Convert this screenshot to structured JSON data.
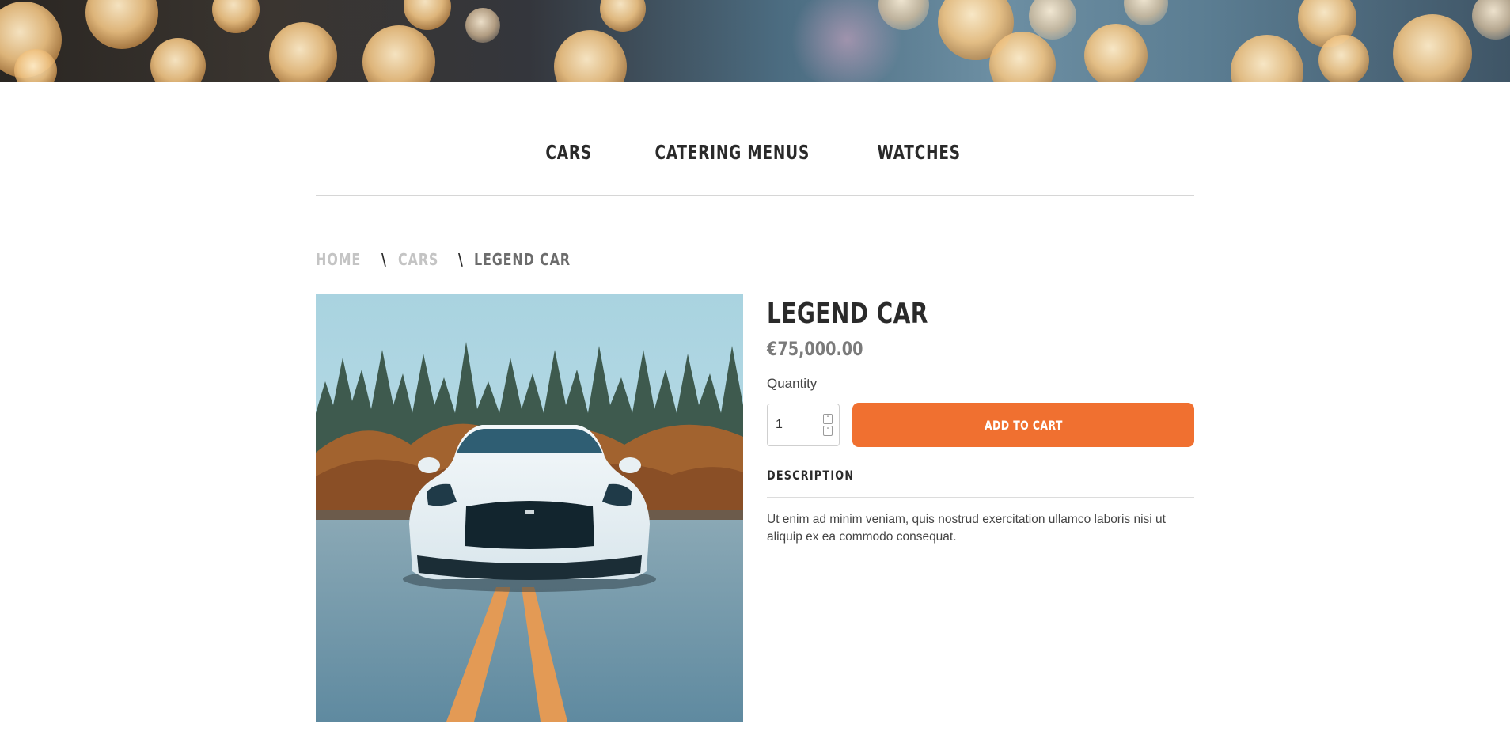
{
  "nav": {
    "items": [
      {
        "label": "CARS"
      },
      {
        "label": "CATERING MENUS"
      },
      {
        "label": "WATCHES"
      }
    ]
  },
  "breadcrumb": {
    "home": "HOME",
    "category": "CARS",
    "current": "LEGEND CAR",
    "separator": "\\"
  },
  "product": {
    "title": "LEGEND CAR",
    "price": "€75,000.00",
    "quantity_label": "Quantity",
    "quantity_value": "1",
    "add_to_cart_label": "ADD TO CART",
    "description_heading": "DESCRIPTION",
    "description_text": "Ut enim ad minim veniam, quis nostrud exercitation ullamco laboris nisi ut aliquip ex ea commodo consequat."
  },
  "colors": {
    "accent": "#f07030",
    "text": "#2a2a2a",
    "muted": "#c4c4c4",
    "price": "#7a7a7a"
  },
  "icons": {
    "stepper_up": "chevron-up-icon",
    "stepper_down": "chevron-down-icon"
  }
}
